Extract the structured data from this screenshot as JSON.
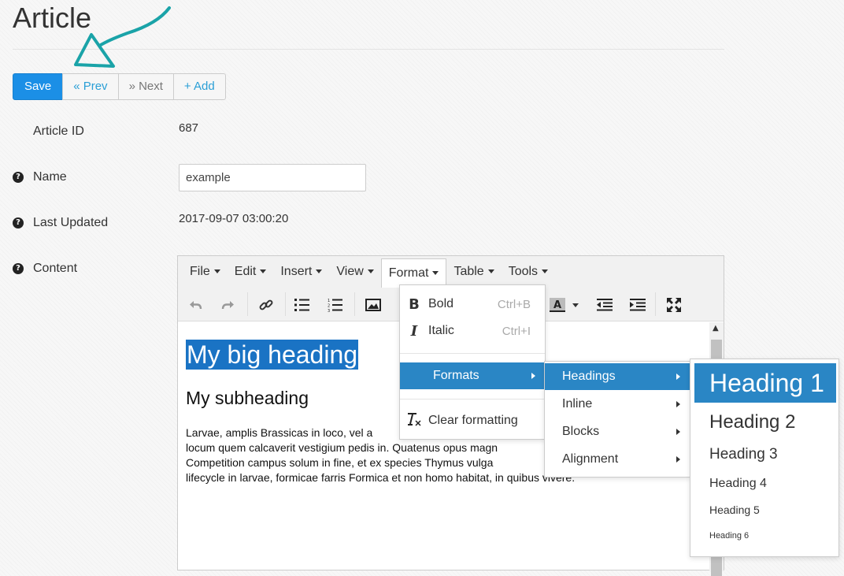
{
  "page": {
    "title": "Article"
  },
  "toolbar_buttons": {
    "save": "Save",
    "prev": "« Prev",
    "next": "» Next",
    "add": "+ Add"
  },
  "fields": {
    "article_id": {
      "label": "Article ID",
      "value": "687"
    },
    "name": {
      "label": "Name",
      "value": "example"
    },
    "last_updated": {
      "label": "Last Updated",
      "value": "2017-09-07 03:00:20"
    },
    "content": {
      "label": "Content"
    }
  },
  "editor": {
    "menus": [
      {
        "label": "File"
      },
      {
        "label": "Edit"
      },
      {
        "label": "Insert"
      },
      {
        "label": "View"
      },
      {
        "label": "Format"
      },
      {
        "label": "Table"
      },
      {
        "label": "Tools"
      }
    ],
    "active_menu": "Format",
    "content": {
      "heading": "My big heading",
      "subheading": "My subheading",
      "paragraph": "Larvae, amplis Brassicas in loco, vel alucita... locum quem calcaverit vestigium pedis in. Quatenus opus magna... Competition campus solum in fine, et ex species Thymus vulgaris... lifecycle in larvae, formicae farris Formica et non homo habitat, in quibus vivere.",
      "para_lines": [
        "Larvae, amplis Brassicas in loco, vel a",
        "locum quem calcaverit vestigium pedis in. Quatenus opus magn",
        "Competition campus solum in fine, et ex species Thymus vulga",
        "lifecycle in larvae, formicae farris Formica et non homo habitat, in quibus vivere."
      ]
    },
    "format_menu": {
      "items": [
        {
          "icon": "B",
          "label": "Bold",
          "shortcut": "Ctrl+B"
        },
        {
          "icon": "I",
          "label": "Italic",
          "shortcut": "Ctrl+I"
        }
      ],
      "formats": "Formats",
      "clear": "Clear formatting"
    },
    "formats_submenu": [
      "Headings",
      "Inline",
      "Blocks",
      "Alignment"
    ],
    "headings_submenu": [
      "Heading 1",
      "Heading 2",
      "Heading 3",
      "Heading 4",
      "Heading 5",
      "Heading 6"
    ]
  },
  "colors": {
    "primary": "#1b8fe6",
    "link": "#2a9fd6",
    "selection": "#2a86c5",
    "annotation_arrow": "#1aa3a8"
  }
}
